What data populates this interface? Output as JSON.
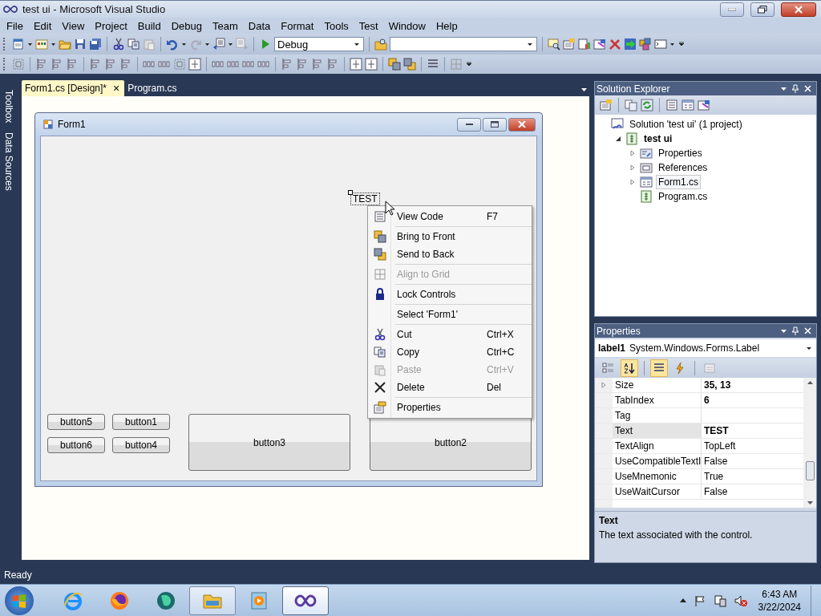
{
  "window": {
    "title": "test ui - Microsoft Visual Studio"
  },
  "menu": [
    "File",
    "Edit",
    "View",
    "Project",
    "Build",
    "Debug",
    "Team",
    "Data",
    "Format",
    "Tools",
    "Test",
    "Window",
    "Help"
  ],
  "toolbar": {
    "configuration": "Debug"
  },
  "side_tabs": [
    "Toolbox",
    "Data Sources"
  ],
  "doc_tabs": [
    {
      "label": "Form1.cs [Design]*",
      "selected": true,
      "close": "×"
    },
    {
      "label": "Program.cs",
      "selected": false
    }
  ],
  "form": {
    "title": "Form1",
    "label": "TEST",
    "buttons": [
      {
        "label": "button5",
        "kind": "small"
      },
      {
        "label": "button1",
        "kind": "small"
      },
      {
        "label": "button6",
        "kind": "small"
      },
      {
        "label": "button4",
        "kind": "small"
      },
      {
        "label": "button3",
        "kind": "large"
      },
      {
        "label": "button2",
        "kind": "large"
      }
    ]
  },
  "context_menu": [
    {
      "kind": "item",
      "label": "View Code",
      "shortcut": "F7",
      "disabled": false
    },
    {
      "kind": "separator"
    },
    {
      "kind": "item",
      "label": "Bring to Front",
      "disabled": false
    },
    {
      "kind": "item",
      "label": "Send to Back",
      "disabled": false
    },
    {
      "kind": "separator"
    },
    {
      "kind": "item",
      "label": "Align to Grid",
      "disabled": true
    },
    {
      "kind": "separator"
    },
    {
      "kind": "item",
      "label": "Lock Controls",
      "disabled": false
    },
    {
      "kind": "separator"
    },
    {
      "kind": "item",
      "label": "Select 'Form1'",
      "disabled": false
    },
    {
      "kind": "separator"
    },
    {
      "kind": "item",
      "label": "Cut",
      "shortcut": "Ctrl+X",
      "disabled": false
    },
    {
      "kind": "item",
      "label": "Copy",
      "shortcut": "Ctrl+C",
      "disabled": false
    },
    {
      "kind": "item",
      "label": "Paste",
      "shortcut": "Ctrl+V",
      "disabled": true
    },
    {
      "kind": "item",
      "label": "Delete",
      "shortcut": "Del",
      "disabled": false
    },
    {
      "kind": "separator"
    },
    {
      "kind": "item",
      "label": "Properties",
      "disabled": false
    }
  ],
  "solution_explorer": {
    "title": "Solution Explorer",
    "tree": [
      {
        "label": "Solution 'test ui' (1 project)",
        "kind": "solution",
        "bold": false,
        "selected": false,
        "children": [
          {
            "label": "test ui",
            "kind": "project",
            "bold": true,
            "selected": false,
            "expanded": true,
            "children": [
              {
                "label": "Properties",
                "kind": "folder",
                "bold": false,
                "selected": false,
                "expanded": false
              },
              {
                "label": "References",
                "kind": "references",
                "bold": false,
                "selected": false,
                "expanded": false
              },
              {
                "label": "Form1.cs",
                "kind": "form",
                "bold": false,
                "selected": true,
                "expanded": false
              },
              {
                "label": "Program.cs",
                "kind": "file",
                "bold": false,
                "selected": false
              }
            ]
          }
        ]
      }
    ]
  },
  "properties": {
    "title": "Properties",
    "object_name": "label1",
    "object_type": "System.Windows.Forms.Label",
    "view_buttons": [
      {
        "selected": false
      },
      {
        "selected": true
      },
      {
        "selected": true
      },
      {
        "selected": false
      },
      {
        "selected": false
      }
    ],
    "rows": [
      {
        "name": "Size",
        "value": "35, 13",
        "modified": true,
        "selected": false,
        "expanded": false
      },
      {
        "name": "TabIndex",
        "value": "6",
        "modified": true,
        "selected": false
      },
      {
        "name": "Tag",
        "selected": false
      },
      {
        "name": "Text",
        "value": "TEST",
        "modified": true,
        "selected": true
      },
      {
        "name": "TextAlign",
        "value": "TopLeft",
        "modified": false,
        "selected": false
      },
      {
        "name": "UseCompatibleTextI",
        "value": "False",
        "modified": false,
        "selected": false
      },
      {
        "name": "UseMnemonic",
        "value": "True",
        "modified": false,
        "selected": false
      },
      {
        "name": "UseWaitCursor",
        "value": "False",
        "modified": false,
        "selected": false
      }
    ],
    "description_title": "Text",
    "description": "The text associated with the control."
  },
  "status_bar": "Ready",
  "taskbar": {
    "apps": [
      {
        "kind": "ie",
        "open": false,
        "selected": false
      },
      {
        "kind": "firefox",
        "open": false,
        "selected": false
      },
      {
        "kind": "globe",
        "open": false,
        "selected": false
      },
      {
        "kind": "explorer",
        "open": true,
        "selected": false
      },
      {
        "kind": "media",
        "open": false,
        "selected": false
      },
      {
        "kind": "visual-studio",
        "open": true,
        "selected": true
      }
    ],
    "time": "6:43 AM",
    "date": "3/22/2024"
  }
}
